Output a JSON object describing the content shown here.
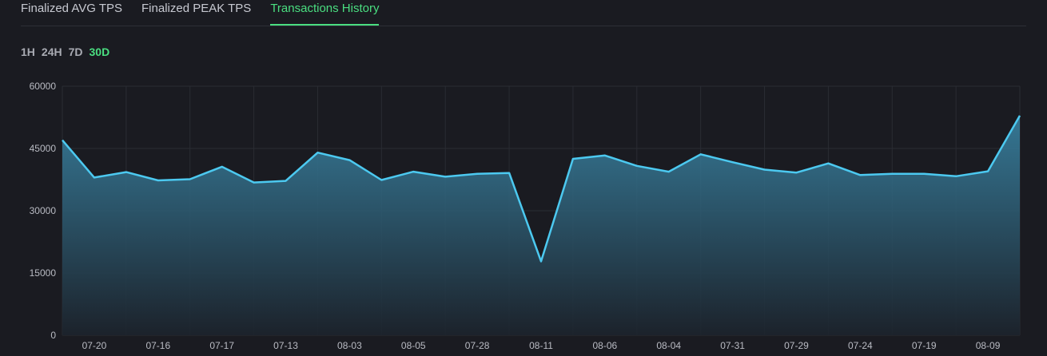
{
  "tabs": [
    {
      "label": "Finalized AVG TPS",
      "active": false
    },
    {
      "label": "Finalized PEAK TPS",
      "active": false
    },
    {
      "label": "Transactions History",
      "active": true
    }
  ],
  "ranges": [
    {
      "label": "1H",
      "active": false
    },
    {
      "label": "24H",
      "active": false
    },
    {
      "label": "7D",
      "active": false
    },
    {
      "label": "30D",
      "active": true
    }
  ],
  "colors": {
    "accent": "#4ade80",
    "line": "#4cc9f0",
    "background": "#1a1b21"
  },
  "chart_data": {
    "type": "area",
    "title": "",
    "xlabel": "",
    "ylabel": "",
    "ylim": [
      0,
      60000
    ],
    "yticks": [
      0,
      15000,
      30000,
      45000,
      60000
    ],
    "grid": true,
    "x_tick_labels": [
      "07-20",
      "07-16",
      "07-17",
      "07-13",
      "08-03",
      "08-05",
      "07-28",
      "08-11",
      "08-06",
      "08-04",
      "07-31",
      "07-29",
      "07-24",
      "07-19",
      "08-09"
    ],
    "series": [
      {
        "values": [
          47000,
          38000,
          39300,
          37300,
          37600,
          40600,
          36800,
          37200,
          44000,
          42200,
          37400,
          39400,
          38200,
          38900,
          39100,
          17800,
          42500,
          43300,
          40800,
          39400,
          43600,
          41700,
          39900,
          39200,
          41400,
          38600,
          38900,
          38900,
          38300,
          39500,
          52900
        ]
      }
    ]
  }
}
